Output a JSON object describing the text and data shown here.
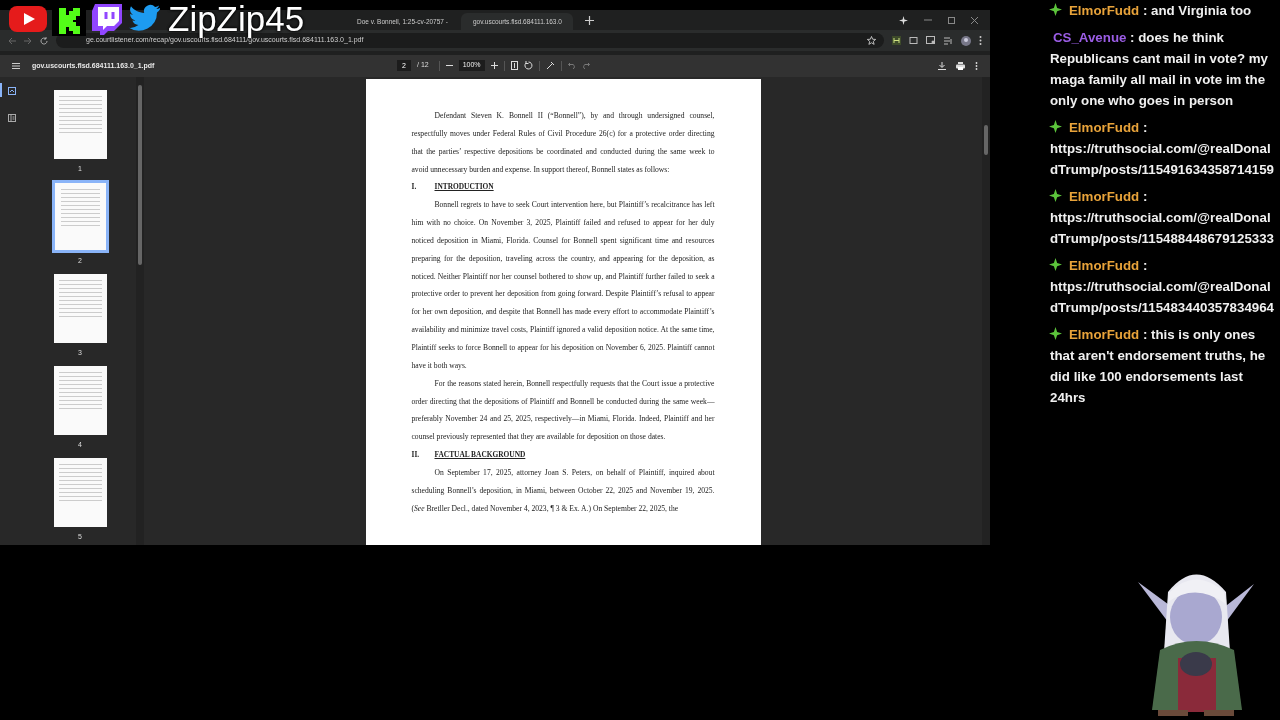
{
  "overlay": {
    "channel_name": "ZipZip45"
  },
  "tabs": [
    {
      "title": "Doe v. Bonnell, 1:25-cv-20757 -",
      "selected": false
    },
    {
      "title": "gov.uscourts.flsd.684111.163.0",
      "selected": true
    }
  ],
  "address_bar": {
    "url": "ge.courtlistener.com/recap/gov.uscourts.flsd.684111/gov.uscourts.flsd.684111.163.0_1.pdf"
  },
  "pdf_toolbar": {
    "filename": "gov.uscourts.flsd.684111.163.0_1.pdf",
    "page": "2",
    "page_total": "/ 12",
    "zoom": "100%"
  },
  "thumbnails": [
    {
      "label": "1",
      "selected": false
    },
    {
      "label": "2",
      "selected": true
    },
    {
      "label": "3",
      "selected": false
    },
    {
      "label": "4",
      "selected": false
    },
    {
      "label": "5",
      "selected": false
    }
  ],
  "document": [
    {
      "kind": "para",
      "text": "Defendant Steven K. Bonnell II (“Bonnell”), by and through undersigned counsel, respectfully moves under Federal Rules of Civil Procedure 26(c) for a protective order directing that the parties’ respective depositions be coordinated and conducted during the same week to avoid unnecessary burden and expense. In support thereof, Bonnell states as follows:"
    },
    {
      "kind": "heading",
      "number": "I.",
      "text": "INTRODUCTION"
    },
    {
      "kind": "para",
      "text": "Bonnell regrets to have to seek Court intervention here, but Plaintiff’s recalcitrance has left him with no choice. On November 3, 2025, Plaintiff failed and refused to appear for her duly noticed deposition in Miami, Florida. Counsel for Bonnell spent significant time and resources preparing for the deposition, traveling across the country, and appearing for the deposition, as noticed. Neither Plaintiff nor her counsel bothered to show up, and Plaintiff further failed to seek a protective order to prevent her deposition from going forward. Despite Plaintiff’s refusal to appear for her own deposition, and despite that Bonnell has made every effort to accommodate Plaintiff’s availability and minimize travel costs, Plaintiff  ignored a valid deposition notice. At the same time, Plaintiff seeks to force Bonnell to appear for his deposition on November 6, 2025. Plaintiff cannot have it both ways."
    },
    {
      "kind": "para",
      "text": "For the reasons stated herein, Bonnell respectfully requests that the Court issue a protective order directing that the depositions of Plaintiff and Bonnell be conducted during the same week—preferably November 24 and 25, 2025, respectively—in Miami, Florida. Indeed, Plaintiff and her counsel previously represented that they are available for deposition on those dates."
    },
    {
      "kind": "heading",
      "number": "II.",
      "text": "FACTUAL BACKGROUND"
    },
    {
      "kind": "para",
      "text": "On September 17, 2025, attorney Joan S. Peters, on behalf of Plaintiff, inquired about scheduling Bonnell’s deposition, in Miami, between October 22, 2025 and November 19, 2025. (*See* Bretller Decl., dated November 4, 2023, ¶ 3 & Ex. A.) On September 22, 2025, the"
    }
  ],
  "chat": [
    {
      "user": "ElmorFudd",
      "color": "#e8a33a",
      "badge": true,
      "text": ": and Virginia too"
    },
    {
      "user": "CS_Avenue",
      "color": "#9b5de5",
      "badge": false,
      "text": ": does he think Republicans cant mail in vote? my maga family all mail in vote im the only one who goes in person"
    },
    {
      "user": "ElmorFudd",
      "color": "#e8a33a",
      "badge": true,
      "text": ": https://truthsocial.com/@realDonaldTrump/posts/115491634358714159"
    },
    {
      "user": "ElmorFudd",
      "color": "#e8a33a",
      "badge": true,
      "text": ": https://truthsocial.com/@realDonaldTrump/posts/115488448679125333"
    },
    {
      "user": "ElmorFudd",
      "color": "#e8a33a",
      "badge": true,
      "text": ": https://truthsocial.com/@realDonaldTrump/posts/115483440357834964"
    },
    {
      "user": "ElmorFudd",
      "color": "#e8a33a",
      "badge": true,
      "text": ": this is only ones that aren't endorsement truths, he did like 100 endorsements last 24hrs"
    }
  ]
}
